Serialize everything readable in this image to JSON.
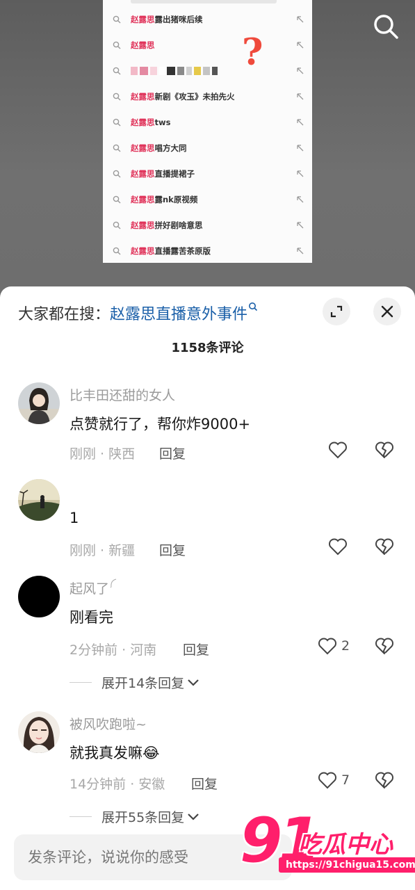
{
  "suggestions": [
    {
      "hl": "赵露思",
      "rest": "露出猪咪后续"
    },
    {
      "hl": "赵露思",
      "rest": ""
    },
    {
      "hl": "",
      "rest": ""
    },
    {
      "hl": "赵露思",
      "rest": "新剧《攻玉》未拍先火"
    },
    {
      "hl": "赵露思",
      "rest": "tws"
    },
    {
      "hl": "赵露思",
      "rest": "唱方大同"
    },
    {
      "hl": "赵露思",
      "rest": "直播提裙子"
    },
    {
      "hl": "赵露思",
      "rest": "露nk原视频"
    },
    {
      "hl": "赵露思",
      "rest": "拼好剧啥意思"
    },
    {
      "hl": "赵露思",
      "rest": "直播露苦茶原版"
    }
  ],
  "overlay": {
    "question_mark": "?"
  },
  "header": {
    "prefix": "大家都在搜：",
    "query": "赵露思直播意外事件",
    "count": "1158条评论"
  },
  "comments": [
    {
      "name": "比丰田还甜的女人",
      "text": "点赞就行了，帮你炸9000+",
      "meta": "刚刚 · 陕西",
      "reply": "回复",
      "likes": "",
      "expand": ""
    },
    {
      "name": "",
      "text": "1",
      "meta": "刚刚 · 新疆",
      "reply": "回复",
      "likes": "",
      "expand": ""
    },
    {
      "name": "起风了",
      "text": "刚看完",
      "meta": "2分钟前 · 河南",
      "reply": "回复",
      "likes": "2",
      "expand": "展开14条回复"
    },
    {
      "name": "被风吹跑啦~",
      "text": "就我真发嘛😂",
      "meta": "14分钟前 · 安徽",
      "reply": "回复",
      "likes": "7",
      "expand": "展开55条回复"
    }
  ],
  "input": {
    "placeholder": "发条评论，说说你的感受"
  },
  "watermark": {
    "num": "91",
    "cn": "吃瓜中心",
    "url": "https://91chigua15.com"
  },
  "icons": {
    "search": "search-icon",
    "expand": "expand-icon",
    "close": "close-icon",
    "heart": "heart-icon",
    "broken_heart": "broken-heart-icon"
  },
  "colors": {
    "highlight": "#e0335a",
    "link": "#1a5fa8",
    "watermark": "#ff1f6b"
  }
}
